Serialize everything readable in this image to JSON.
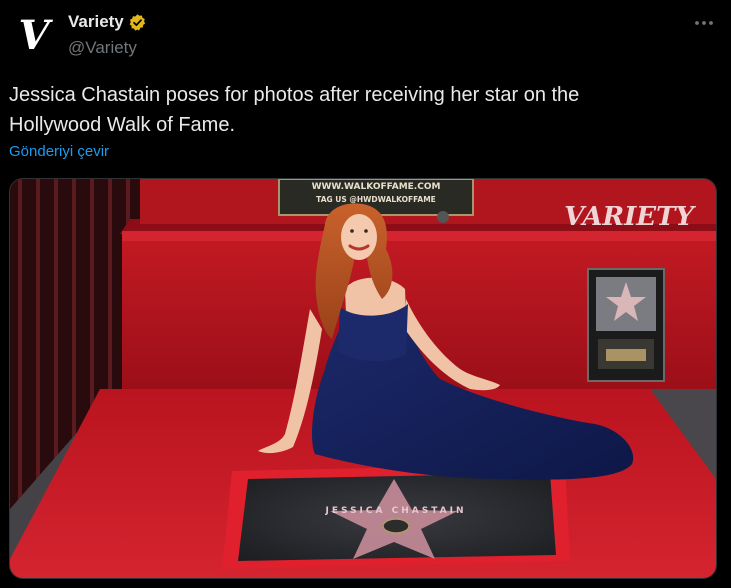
{
  "author": {
    "display_name": "Variety",
    "handle": "@Variety",
    "avatar_letter": "V",
    "verified_icon": "verified-badge-icon"
  },
  "tweet": {
    "text_line1": "Jessica Chastain poses for photos after receiving her star on the",
    "text_line2": "Hollywood Walk of Fame.",
    "translate_label": "Gönderiyi çevir"
  },
  "media": {
    "plaque_line1": "WWW.WALKOFFAME.COM",
    "plaque_line2": "TAG US @HWDWALKOFFAME",
    "watermark": "VARIETY",
    "star_name": "JESSICA CHASTAIN"
  },
  "colors": {
    "background": "#000000",
    "text": "#e7e9ea",
    "muted": "#71767b",
    "link": "#1d9bf0",
    "verified_gold": "#e2b719",
    "carpet_red": "#c61b26"
  }
}
